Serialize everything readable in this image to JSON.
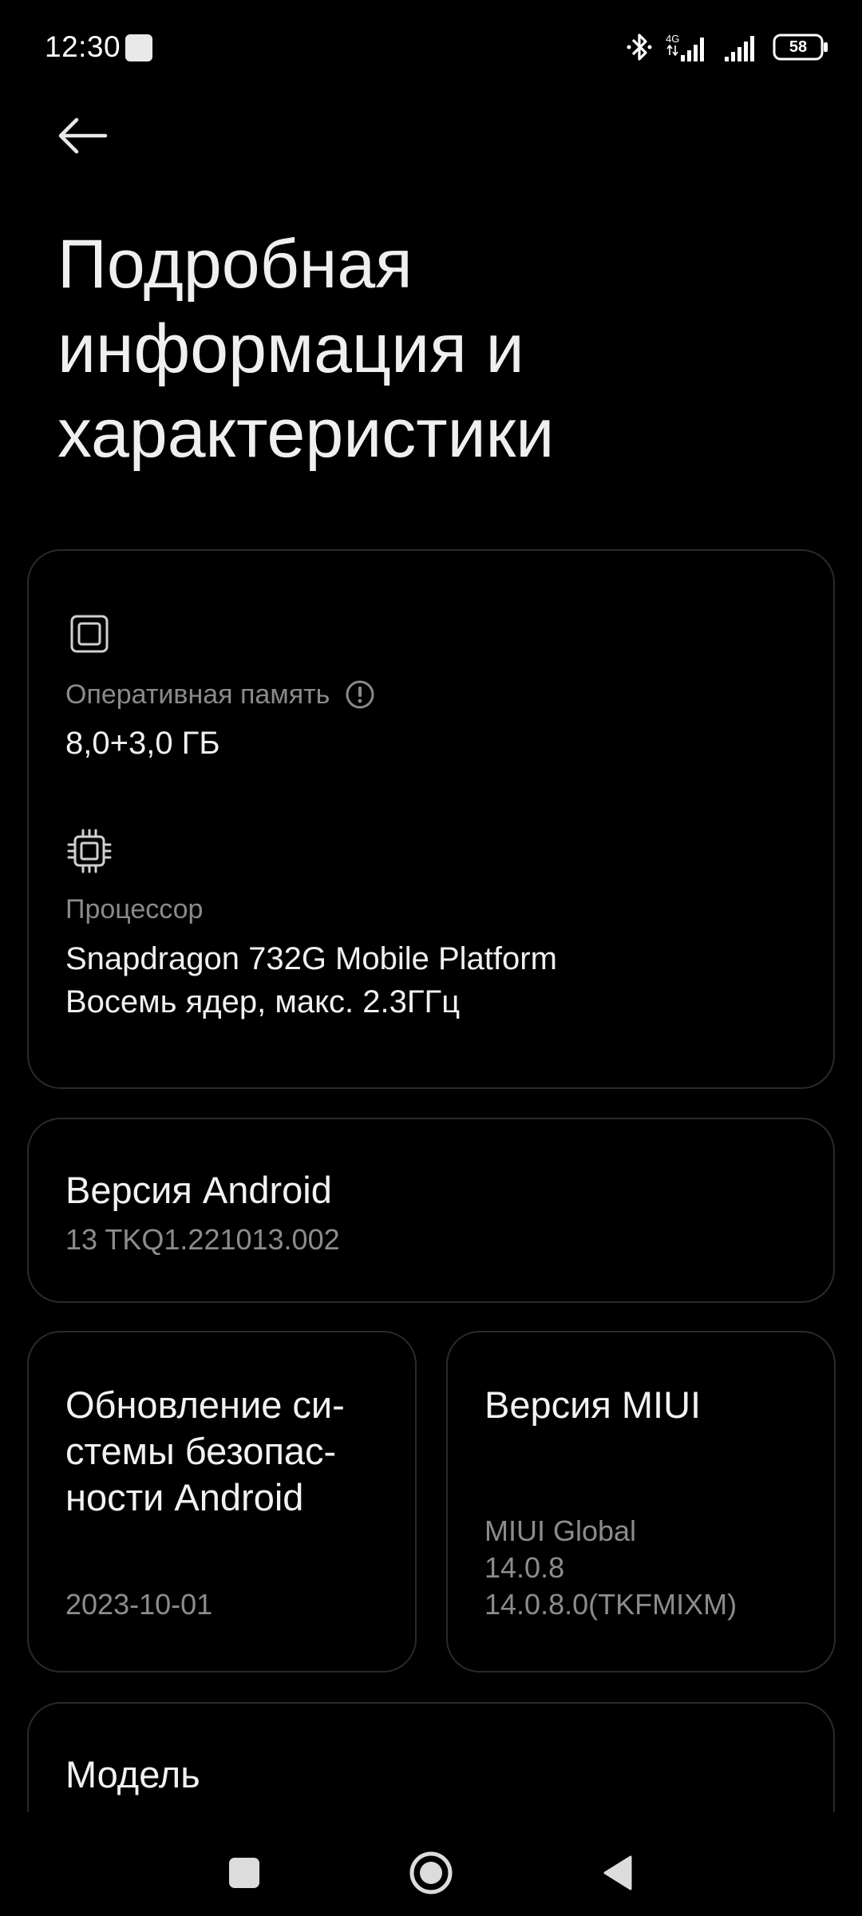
{
  "status_bar": {
    "time": "12:30",
    "network": "4G",
    "battery": "58",
    "icons": [
      "bluetooth-icon",
      "signal-icon",
      "signal-icon",
      "battery-icon"
    ]
  },
  "header": {
    "back_icon": "arrow-left-icon",
    "title": "Подробная информация и характеристики"
  },
  "specs": {
    "ram": {
      "icon": "chip-icon",
      "label": "Оперативная память",
      "info_icon": "info-icon",
      "value": "8,0+3,0 ГБ"
    },
    "cpu": {
      "icon": "processor-icon",
      "label": "Процессор",
      "value_line1": "Snapdragon 732G Mobile Platform",
      "value_line2": "Восемь ядер, макс. 2.3ГГц"
    }
  },
  "android": {
    "title": "Версия Android",
    "value": "13 TKQ1.221013.002"
  },
  "security": {
    "title_line1": "Обновление си-",
    "title_line2": "стемы безопас-",
    "title_line3": "ности Android",
    "value": "2023-10-01"
  },
  "miui": {
    "title": "Версия MIUI",
    "value_line1": "MIUI Global",
    "value_line2": "14.0.8",
    "value_line3": "14.0.8.0(TKFMIXM)"
  },
  "model": {
    "title": "Модель"
  },
  "nav": {
    "recents_icon": "square-icon",
    "home_icon": "circle-icon",
    "back_icon": "triangle-back-icon"
  },
  "colors": {
    "background": "#000000",
    "card_border": "#2a2a2a",
    "text_primary": "#f0f0f0",
    "text_secondary": "#8a8a8a"
  }
}
